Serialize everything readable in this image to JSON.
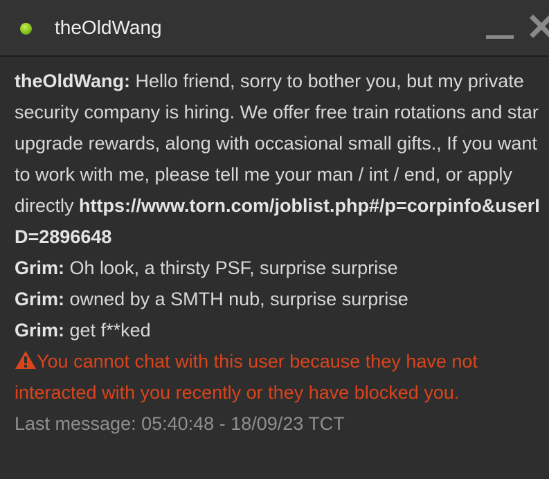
{
  "header": {
    "title": "theOldWang",
    "status_color": "#86c21f"
  },
  "messages": [
    {
      "author": "theOldWang:",
      "text": " Hello friend, sorry to bother you, but my private security company is hiring. We offer free train rotations and star upgrade rewards, along with occasional small gifts., If you want to work with me, please tell me your man / int / end, or apply directly ",
      "link": "https://www.torn.com/joblist.php#/p=corpinfo&userID=2896648"
    },
    {
      "author": "Grim:",
      "text": " Oh look, a thirsty PSF, surprise surprise"
    },
    {
      "author": "Grim:",
      "text": " owned by a SMTH nub, surprise surprise"
    },
    {
      "author": "Grim:",
      "text": " get f**ked"
    }
  ],
  "warning": {
    "icon": "warning-triangle-icon",
    "text": "You cannot chat with this user because they have not interacted with you recently or they have blocked you.",
    "color": "#d9441c"
  },
  "footer": {
    "last_message": "Last message: 05:40:48 - 18/09/23 TCT"
  },
  "controls": {
    "minimize_icon": "minimize-icon",
    "close_icon": "close-icon"
  }
}
